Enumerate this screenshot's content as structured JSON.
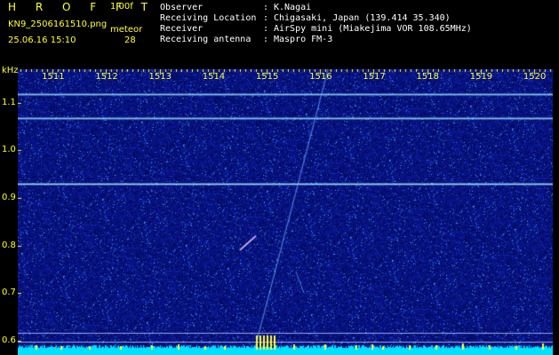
{
  "header": {
    "app_name": "HROFFT",
    "version": "1.00f",
    "filename": "KN9_2506161510.png",
    "mode": "meteor",
    "datetime": "25.06.16 15:10",
    "count": "28",
    "info": [
      {
        "label": "Observer",
        "value": "K.Nagai"
      },
      {
        "label": "Receiving Location",
        "value": "Chigasaki, Japan (139.414 35.340)"
      },
      {
        "label": "Receiver",
        "value": "AirSpy mini (Miakejima VOR 108.65MHz)"
      },
      {
        "label": "Receiving antenna",
        "value": "Maspro FM-3"
      }
    ]
  },
  "axes": {
    "y_unit": "kHz",
    "y_ticks": [
      "1.1",
      "1.0",
      "0.9",
      "0.8",
      "0.7",
      "0.6"
    ],
    "x_ticks": [
      "1511",
      "1512",
      "1513",
      "1514",
      "1515",
      "1516",
      "1517",
      "1518",
      "1519",
      "1520"
    ]
  },
  "colors": {
    "background": "#000000",
    "label_yellow": "#ffff33",
    "noise_base": "#0a1a8a",
    "carrier": "#9fe8ff",
    "baseline_cyan": "#00e0ff"
  },
  "spectrum": {
    "y_range_khz": [
      0.57,
      1.17
    ],
    "x_range_s": [
      1510.35,
      1520.35
    ],
    "carrier_lines_khz": [
      1.117,
      1.067,
      0.93
    ],
    "guide_lines_khz": [
      0.616,
      0.598
    ],
    "meteor_trail": [
      [
        1516.15,
        1.17
      ],
      [
        1514.75,
        0.57
      ]
    ],
    "meteor_short": [
      [
        1514.5,
        0.79
      ],
      [
        1514.8,
        0.82
      ]
    ],
    "meteor_faint": [
      [
        1515.55,
        0.745
      ],
      [
        1515.7,
        0.7
      ]
    ]
  }
}
